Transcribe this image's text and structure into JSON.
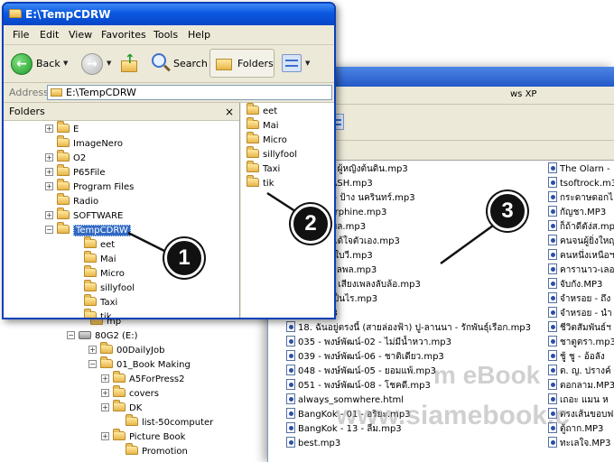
{
  "window": {
    "title": "E:\\TempCDRW",
    "menu": [
      "File",
      "Edit",
      "View",
      "Favorites",
      "Tools",
      "Help"
    ],
    "toolbar": {
      "back_label": "Back",
      "search_label": "Search",
      "folders_label": "Folders"
    },
    "address": {
      "label": "Address",
      "value": "E:\\TempCDRW"
    }
  },
  "folders_pane": {
    "header": "Folders",
    "close": "×",
    "tree": [
      {
        "label": "E",
        "expander": "+"
      },
      {
        "label": "ImageNero",
        "expander": ""
      },
      {
        "label": "O2",
        "expander": "+"
      },
      {
        "label": "P65File",
        "expander": "+"
      },
      {
        "label": "Program Files",
        "expander": "+"
      },
      {
        "label": "Radio",
        "expander": ""
      },
      {
        "label": "SOFTWARE",
        "expander": "+"
      },
      {
        "label": "TempCDRW",
        "expander": "−",
        "selected": true
      },
      {
        "label": "eet",
        "expander": "",
        "child": true
      },
      {
        "label": "Mai",
        "expander": "",
        "child": true
      },
      {
        "label": "Micro",
        "expander": "",
        "child": true
      },
      {
        "label": "sillyfool",
        "expander": "",
        "child": true
      },
      {
        "label": "Taxi",
        "expander": "",
        "child": true
      },
      {
        "label": "tik",
        "expander": "",
        "child": true
      }
    ]
  },
  "contents_pane": [
    "eet",
    "Mai",
    "Micro",
    "sillyfool",
    "Taxi",
    "tik"
  ],
  "tree_below": {
    "partial": "mp",
    "drive": "80G2 (E:)",
    "items": [
      {
        "label": "00DailyJob",
        "expander": "+"
      },
      {
        "label": "01_Book Making",
        "expander": "−"
      },
      {
        "label": "A5ForPress2",
        "expander": "+"
      },
      {
        "label": "covers",
        "expander": "+"
      },
      {
        "label": "DK",
        "expander": "+"
      },
      {
        "label": "list-50computer",
        "expander": ""
      },
      {
        "label": "Picture Book",
        "expander": "+"
      },
      {
        "label": "Promotion",
        "expander": ""
      }
    ]
  },
  "back_window": {
    "menu_tail": "ws XP",
    "files_col1_hidden": [
      "งต้นดิน - ปิ๊ม ผู้หญิงต้นดิน.mp3",
      "ออะไร - CLASH.mp3",
      "รไรสักอย่าง - ป้าง นครินทร์.mp3",
      "สนิท - Endorphine.mp3",
      "head - เหตุผล.mp3",
      "RAPAT - ไม่ได้ใจตัวเอง.mp3",
      "คนที่คิดถึง - ใบวี.mp3",
      "เต็มสลาย - พลพล.mp3",
      "แคนเช่นใด - เสียงเพลงลับล้อ.mp3",
      "ร้องไห้ - ไม่เป็นไร.mp3",
      "- พลพล.mp3"
    ],
    "files_col1_visible": [
      "18. ฉันอยู่ตรงนี้ (สายล่องฟ้า) ปู-ลานนา - รักพันธุ์เรือก.mp3",
      "035 - พงษ์พัฒน์-02 - ไม่มีน้ำหวา.mp3",
      "039 - พงษ์พัฒน์-06 - ชาติเดียว.mp3",
      "048 - พงษ์พัฒน์-05 - ยอมแพ้.mp3",
      "051 - พงษ์พัฒน์-08 - โชคดี.mp3",
      "always_somwhere.html",
      "BangKok - 01 - อริยะ.mp3",
      "BangKok - 13 - ลืม.mp3",
      "best.mp3"
    ],
    "files_col2": [
      "The Olarn - ",
      "tsoftrock.m3",
      "กระดาษดอกไ",
      "กัญชา.MP3",
      "ก็ถ้าดีตัง่ส.mp",
      "คนจนผู้ยิ่งใหญ",
      "คนหนึ่งเหนือฯ",
      "คารานาว-เลอ",
      "จับกัง.MP3",
      "จำหรอย - ถึง",
      "จำหรอย - นำ",
      "ชีวิตสัมพันธ์ฯ",
      "ชาตูตรา.mp3",
      "ชู้ ชู - อ้อลัง",
      "ต. ญ. ปรางค์",
      "ตอกลาม.MP3",
      "เถอะ แมน ห",
      "ตรงเส้นขอบฟ",
      "ตู้ถาก.MP3",
      "ทะเลใจ.MP3"
    ]
  },
  "callouts": [
    "1",
    "2",
    "3"
  ],
  "watermark": {
    "line1": "m eBook",
    "line2": "www.siamebook.c"
  }
}
